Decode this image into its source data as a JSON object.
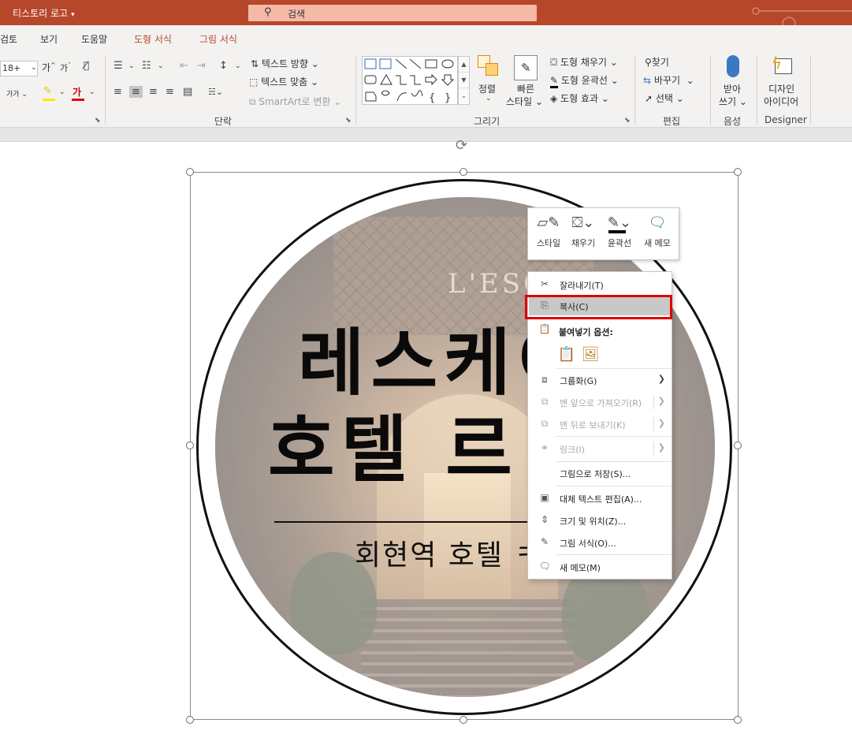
{
  "titlebar": {
    "doc_title": "티스토리 로고",
    "search_placeholder": "검색"
  },
  "tabs": [
    "검토",
    "보기",
    "도움말",
    "도형 서식",
    "그림 서식"
  ],
  "ribbon": {
    "font_size": "18+",
    "text_direction": "텍스트 방향",
    "text_align": "텍스트 맞춤",
    "smartart": "SmartArt로 변환",
    "arrange": "정렬",
    "quick_styles_line1": "빠른",
    "quick_styles_line2": "스타일",
    "shape_fill": "도형 채우기",
    "shape_outline": "도형 윤곽선",
    "shape_effects": "도형 효과",
    "find": "찾기",
    "replace": "바꾸기",
    "select": "선택",
    "dictate_line1": "받아",
    "dictate_line2": "쓰기",
    "design_line1": "디자인",
    "design_line2": "아이디어",
    "groups": {
      "paragraph": "단락",
      "drawing": "그리기",
      "editing": "편집",
      "voice": "음성",
      "designer": "Designer"
    },
    "font_grow": "가",
    "font_shrink": "가",
    "font_color_letter": "가",
    "char_spacing": "가가"
  },
  "slide": {
    "sign_text": "L'ESCAPE",
    "logo_line1": "레스케이",
    "logo_line2": "호텔 르",
    "logo_subtitle": "회현역 호텔 ㅋ"
  },
  "mini_toolbar": {
    "style": "스타일",
    "fill": "채우기",
    "outline": "윤곽선",
    "new_comment": "새 메모"
  },
  "context_menu": {
    "cut": "잘라내기(T)",
    "copy": "복사(C)",
    "paste_options": "붙여넣기 옵션:",
    "group": "그룹화(G)",
    "bring_to_front": "맨 앞으로 가져오기(R)",
    "send_to_back": "맨 뒤로 보내기(K)",
    "link": "링크(I)",
    "save_as_picture": "그림으로 저장(S)...",
    "edit_alt_text": "대체 텍스트 편집(A)...",
    "size_position": "크기 및 위치(Z)...",
    "format_picture": "그림 서식(O)...",
    "new_comment": "새 메모(M)"
  },
  "colors": {
    "accent": "#b7472a",
    "highlight_box": "#e00000",
    "menu_hover": "#c8c8c8"
  }
}
